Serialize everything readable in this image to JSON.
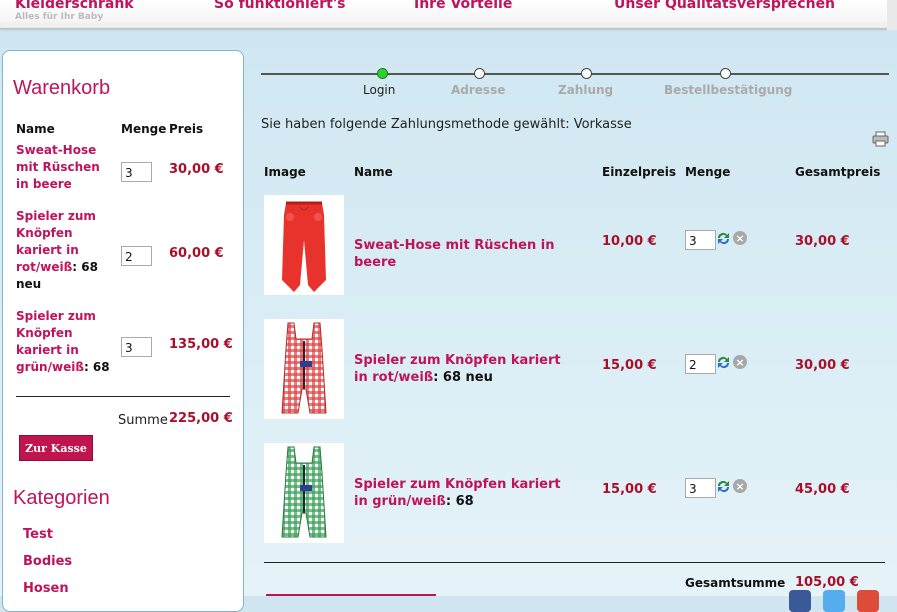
{
  "nav": {
    "items": [
      "Kleiderschrank",
      "So funktioniert's",
      "Ihre Vorteile",
      "Unser Qualitätsversprechen"
    ],
    "tagline": "Alles für Ihr Baby"
  },
  "cart": {
    "title": "Warenkorb",
    "headers": {
      "name": "Name",
      "qty": "Menge",
      "price": "Preis"
    },
    "items": [
      {
        "name": "Sweat-Hose mit Rüschen in beere",
        "variant": "",
        "qty": "3",
        "price": "30,00 €"
      },
      {
        "name": "Spieler zum Knöpfen kariert in rot/weiß",
        "variant": ": 68 neu",
        "qty": "2",
        "price": "60,00 €"
      },
      {
        "name": "Spieler zum Knöpfen kariert in grün/weiß",
        "variant": ": 68",
        "qty": "3",
        "price": "135,00 €"
      }
    ],
    "sum_label": "Summe",
    "sum_value": "225,00 €",
    "checkout_label": "Zur Kasse"
  },
  "categories": {
    "title": "Kategorien",
    "items": [
      "Test",
      "Bodies",
      "Hosen"
    ]
  },
  "progress": {
    "steps": [
      "Login",
      "Adresse",
      "Zahlung",
      "Bestellbestätigung"
    ],
    "active": 0
  },
  "payment_text": "Sie haben folgende Zahlungsmethode gewählt: Vorkasse",
  "table": {
    "headers": {
      "image": "Image",
      "name": "Name",
      "unit": "Einzelpreis",
      "qty": "Menge",
      "total": "Gesamtpreis"
    },
    "rows": [
      {
        "name": "Sweat-Hose mit Rüschen in beere",
        "variant": "",
        "unit": "10,00 €",
        "qty": "3",
        "total": "30,00 €"
      },
      {
        "name": "Spieler zum Knöpfen kariert in rot/weiß",
        "variant": ": 68 neu",
        "unit": "15,00 €",
        "qty": "2",
        "total": "30,00 €"
      },
      {
        "name": "Spieler zum Knöpfen kariert in grün/weiß",
        "variant": ": 68",
        "unit": "15,00 €",
        "qty": "3",
        "total": "45,00 €"
      }
    ],
    "grand_total_label": "Gesamtsumme",
    "grand_total_value": "105,00 €"
  },
  "colors": {
    "accent": "#c0145a",
    "price": "#a8102a",
    "active_step": "#2bd42b"
  }
}
